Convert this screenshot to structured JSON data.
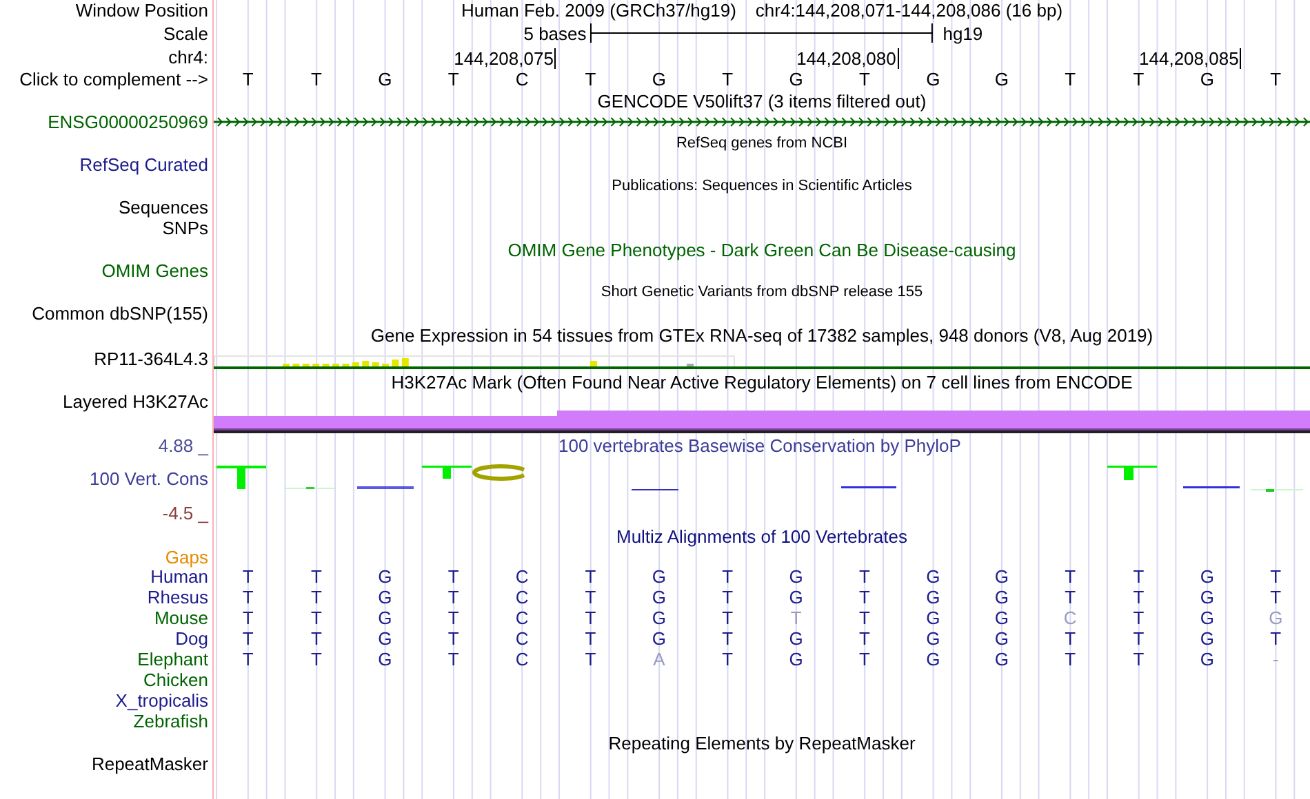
{
  "header": {
    "window_position_label": "Window Position",
    "assembly": "Human Feb. 2009 (GRCh37/hg19)",
    "position": "chr4:144,208,071-144,208,086 (16 bp)",
    "scale_label": "Scale",
    "scale_text": "5 bases",
    "scale_db": "hg19",
    "chrom_label": "chr4:",
    "complement_label": "Click to complement -->",
    "columns": [
      {
        "base": "T"
      },
      {
        "base": "T"
      },
      {
        "base": "G"
      },
      {
        "base": "T"
      },
      {
        "base": "C",
        "tick": "144,208,075"
      },
      {
        "base": "T"
      },
      {
        "base": "G"
      },
      {
        "base": "T"
      },
      {
        "base": "G"
      },
      {
        "base": "T",
        "tick": "144,208,080"
      },
      {
        "base": "G"
      },
      {
        "base": "G"
      },
      {
        "base": "T"
      },
      {
        "base": "T"
      },
      {
        "base": "G",
        "tick": "144,208,085"
      },
      {
        "base": "T"
      }
    ]
  },
  "tracks": [
    {
      "kind": "gene",
      "title": "GENCODE V50lift37 (3 items filtered out)",
      "small_title": false,
      "color": "#000000",
      "labels": [
        {
          "text": "ENSG00000250969",
          "color": "#006400"
        }
      ]
    },
    {
      "kind": "simple",
      "title": "RefSeq genes from NCBI",
      "small_title": true,
      "color": "#000000",
      "labels": [
        {
          "text": "RefSeq Curated",
          "color": "#1c1c8c"
        }
      ]
    },
    {
      "kind": "simple",
      "title": "Publications: Sequences in Scientific Articles",
      "small_title": true,
      "color": "#000000",
      "labels": [
        {
          "text": "Sequences",
          "color": "#000000"
        },
        {
          "text": "SNPs",
          "color": "#000000"
        }
      ]
    },
    {
      "kind": "simple",
      "title": "OMIM Gene Phenotypes - Dark Green Can Be Disease-causing",
      "small_title": false,
      "color": "#006400",
      "labels": [
        {
          "text": "OMIM Genes",
          "color": "#006400"
        }
      ]
    },
    {
      "kind": "simple",
      "title": "Short Genetic Variants from dbSNP release 155",
      "small_title": true,
      "color": "#000000",
      "labels": [
        {
          "text": "Common dbSNP(155)",
          "color": "#000000"
        }
      ]
    },
    {
      "kind": "expression",
      "title": "Gene Expression in 54 tissues from GTEx RNA-seq of 17382 samples, 948 donors (V8, Aug 2019)",
      "small_title": false,
      "color": "#000000",
      "labels": [
        {
          "text": "RP11-364L4.3",
          "color": "#000000"
        }
      ]
    },
    {
      "kind": "signal",
      "title": "H3K27Ac Mark (Often Found Near Active Regulatory Elements) on 7 cell lines from ENCODE",
      "small_title": false,
      "color": "#000000",
      "labels": [
        {
          "text": "Layered H3K27Ac",
          "color": "#000000"
        }
      ]
    },
    {
      "kind": "conservation",
      "title": "100 vertebrates Basewise Conservation by PhyloP",
      "small_title": false,
      "color": "#3c3c99",
      "labels": [
        {
          "text": "100 Vert. Cons",
          "color": "#3c3c99"
        }
      ],
      "max_label": "4.88 _",
      "min_label": "-4.5 _"
    },
    {
      "kind": "alignment",
      "title": "Multiz Alignments of 100 Vertebrates",
      "small_title": false,
      "color": "#101080",
      "gaps_label": "Gaps",
      "species": [
        {
          "name": "Human",
          "color": "#1c1c8c",
          "bases": [
            {
              "letter": "T",
              "faded": false
            },
            {
              "letter": "T",
              "faded": false
            },
            {
              "letter": "G",
              "faded": false
            },
            {
              "letter": "T",
              "faded": false
            },
            {
              "letter": "C",
              "faded": false
            },
            {
              "letter": "T",
              "faded": false
            },
            {
              "letter": "G",
              "faded": false
            },
            {
              "letter": "T",
              "faded": false
            },
            {
              "letter": "G",
              "faded": false
            },
            {
              "letter": "T",
              "faded": false
            },
            {
              "letter": "G",
              "faded": false
            },
            {
              "letter": "G",
              "faded": false
            },
            {
              "letter": "T",
              "faded": false
            },
            {
              "letter": "T",
              "faded": false
            },
            {
              "letter": "G",
              "faded": false
            },
            {
              "letter": "T",
              "faded": false
            }
          ]
        },
        {
          "name": "Rhesus",
          "color": "#1c1c8c",
          "bases": [
            {
              "letter": "T",
              "faded": false
            },
            {
              "letter": "T",
              "faded": false
            },
            {
              "letter": "G",
              "faded": false
            },
            {
              "letter": "T",
              "faded": false
            },
            {
              "letter": "C",
              "faded": false
            },
            {
              "letter": "T",
              "faded": false
            },
            {
              "letter": "G",
              "faded": false
            },
            {
              "letter": "T",
              "faded": false
            },
            {
              "letter": "G",
              "faded": false
            },
            {
              "letter": "T",
              "faded": false
            },
            {
              "letter": "G",
              "faded": false
            },
            {
              "letter": "G",
              "faded": false
            },
            {
              "letter": "T",
              "faded": false
            },
            {
              "letter": "T",
              "faded": false
            },
            {
              "letter": "G",
              "faded": false
            },
            {
              "letter": "T",
              "faded": false
            }
          ]
        },
        {
          "name": "Mouse",
          "color": "#006400",
          "bases": [
            {
              "letter": "T",
              "faded": false
            },
            {
              "letter": "T",
              "faded": false
            },
            {
              "letter": "G",
              "faded": false
            },
            {
              "letter": "T",
              "faded": false
            },
            {
              "letter": "C",
              "faded": false
            },
            {
              "letter": "T",
              "faded": false
            },
            {
              "letter": "G",
              "faded": false
            },
            {
              "letter": "T",
              "faded": false
            },
            {
              "letter": "T",
              "faded": true
            },
            {
              "letter": "T",
              "faded": false
            },
            {
              "letter": "G",
              "faded": false
            },
            {
              "letter": "G",
              "faded": false
            },
            {
              "letter": "C",
              "faded": true
            },
            {
              "letter": "T",
              "faded": false
            },
            {
              "letter": "G",
              "faded": false
            },
            {
              "letter": "G",
              "faded": true
            }
          ]
        },
        {
          "name": "Dog",
          "color": "#1c1c8c",
          "bases": [
            {
              "letter": "T",
              "faded": false
            },
            {
              "letter": "T",
              "faded": false
            },
            {
              "letter": "G",
              "faded": false
            },
            {
              "letter": "T",
              "faded": false
            },
            {
              "letter": "C",
              "faded": false
            },
            {
              "letter": "T",
              "faded": false
            },
            {
              "letter": "G",
              "faded": false
            },
            {
              "letter": "T",
              "faded": false
            },
            {
              "letter": "G",
              "faded": false
            },
            {
              "letter": "T",
              "faded": false
            },
            {
              "letter": "G",
              "faded": false
            },
            {
              "letter": "G",
              "faded": false
            },
            {
              "letter": "T",
              "faded": false
            },
            {
              "letter": "T",
              "faded": false
            },
            {
              "letter": "G",
              "faded": false
            },
            {
              "letter": "T",
              "faded": false
            }
          ]
        },
        {
          "name": "Elephant",
          "color": "#006400",
          "bases": [
            {
              "letter": "T",
              "faded": false
            },
            {
              "letter": "T",
              "faded": false
            },
            {
              "letter": "G",
              "faded": false
            },
            {
              "letter": "T",
              "faded": false
            },
            {
              "letter": "C",
              "faded": false
            },
            {
              "letter": "T",
              "faded": false
            },
            {
              "letter": "A",
              "faded": true
            },
            {
              "letter": "T",
              "faded": false
            },
            {
              "letter": "G",
              "faded": false
            },
            {
              "letter": "T",
              "faded": false
            },
            {
              "letter": "G",
              "faded": false
            },
            {
              "letter": "G",
              "faded": false
            },
            {
              "letter": "T",
              "faded": false
            },
            {
              "letter": "T",
              "faded": false
            },
            {
              "letter": "G",
              "faded": false
            },
            {
              "letter": "-",
              "faded": true
            }
          ]
        },
        {
          "name": "Chicken",
          "color": "#006400"
        },
        {
          "name": "X_tropicalis",
          "color": "#1c1c8c"
        },
        {
          "name": "Zebrafish",
          "color": "#006400"
        }
      ]
    },
    {
      "kind": "simple",
      "title": "Repeating Elements by RepeatMasker",
      "small_title": false,
      "color": "#000000",
      "labels": [
        {
          "text": "RepeatMasker",
          "color": "#000000"
        }
      ]
    }
  ]
}
